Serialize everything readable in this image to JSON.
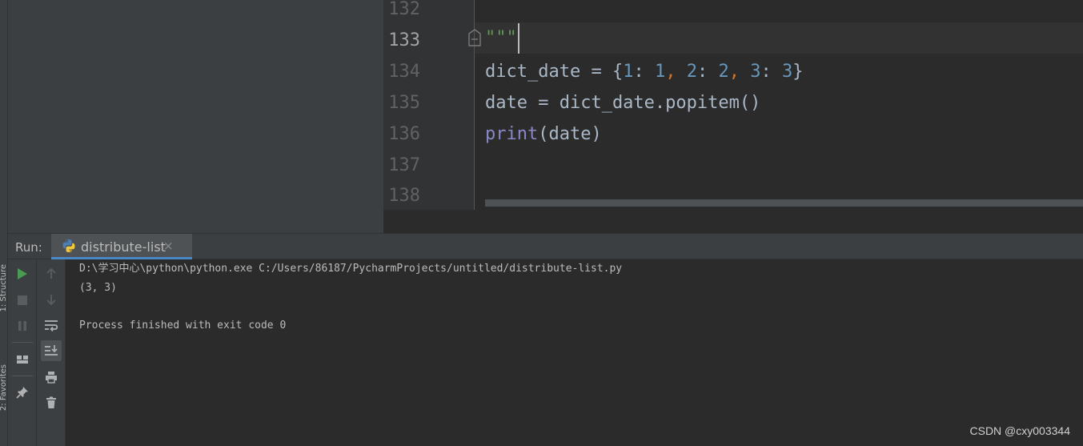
{
  "side_stripe": {
    "structure_label": "1: Structure",
    "favorites_label": "2: Favorites"
  },
  "editor": {
    "line_numbers": [
      "132",
      "133",
      "134",
      "135",
      "136",
      "137",
      "138"
    ],
    "lines": {
      "l133_doc": "\"\"\"",
      "l134_a": "dict_date = {",
      "l134_n1": "1",
      "l134_colon1": ": ",
      "l134_v1": "1",
      "l134_comma1": ", ",
      "l134_n2": "2",
      "l134_colon2": ": ",
      "l134_v2": "2",
      "l134_comma2": ", ",
      "l134_n3": "3",
      "l134_colon3": ": ",
      "l134_v3": "3",
      "l134_close": "}",
      "l135": "date = dict_date.popitem()",
      "l136_builtin": "print",
      "l136_rest": "(date)"
    }
  },
  "run": {
    "title": "Run:",
    "tab_label": "distribute-list",
    "tab_close": "×",
    "icons": {
      "col1": [
        "run-icon",
        "stop-icon",
        "pause-icon",
        "layout-icon",
        "pin-icon"
      ],
      "col2": [
        "up-arrow-icon",
        "down-arrow-icon",
        "soft-wrap-icon",
        "scroll-to-end-icon",
        "print-icon",
        "trash-icon"
      ]
    }
  },
  "console": {
    "lines": [
      "D:\\学习中心\\python\\python.exe C:/Users/86187/PycharmProjects/untitled/distribute-list.py",
      "(3, 3)",
      "",
      "Process finished with exit code 0"
    ]
  },
  "watermark": "CSDN @cxy003344",
  "colors": {
    "editor_bg": "#2b2b2b",
    "panel_bg": "#3c3f41",
    "number": "#6897bb",
    "punctuation": "#cc7832",
    "builtin": "#8888c6",
    "docstring": "#629755",
    "run_green": "#499c54"
  }
}
